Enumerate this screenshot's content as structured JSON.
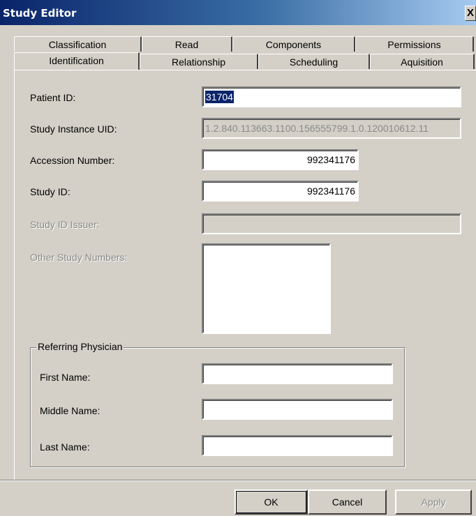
{
  "window": {
    "title": "Study Editor",
    "close_glyph": "X"
  },
  "tabs": {
    "back_row": [
      "Classification",
      "Read",
      "Components",
      "Permissions"
    ],
    "front_row": [
      "Identification",
      "Relationship",
      "Scheduling",
      "Aquisition"
    ],
    "active": "Identification"
  },
  "form": {
    "patient_id": {
      "label": "Patient ID:",
      "value": "31704"
    },
    "study_instance_uid": {
      "label": "Study Instance UID:",
      "value": "1.2.840.113663.1100.156555799.1.0.120010612.11"
    },
    "accession_number": {
      "label": "Accession Number:",
      "value": "992341176"
    },
    "study_id": {
      "label": "Study ID:",
      "value": "992341176"
    },
    "study_id_issuer": {
      "label": "Study ID Issuer:",
      "value": ""
    },
    "other_study_numbers": {
      "label": "Other Study Numbers:",
      "value": ""
    }
  },
  "referring_physician": {
    "legend": "Referring Physician",
    "first_name": {
      "label": "First Name:",
      "value": ""
    },
    "middle_name": {
      "label": "Middle Name:",
      "value": ""
    },
    "last_name": {
      "label": "Last Name:",
      "value": ""
    }
  },
  "buttons": {
    "ok": "OK",
    "cancel": "Cancel",
    "apply": "Apply"
  },
  "colors": {
    "title_gradient_start": "#0a246a",
    "title_gradient_end": "#a6caf0",
    "face": "#d4d0c8",
    "selection": "#0a246a"
  }
}
